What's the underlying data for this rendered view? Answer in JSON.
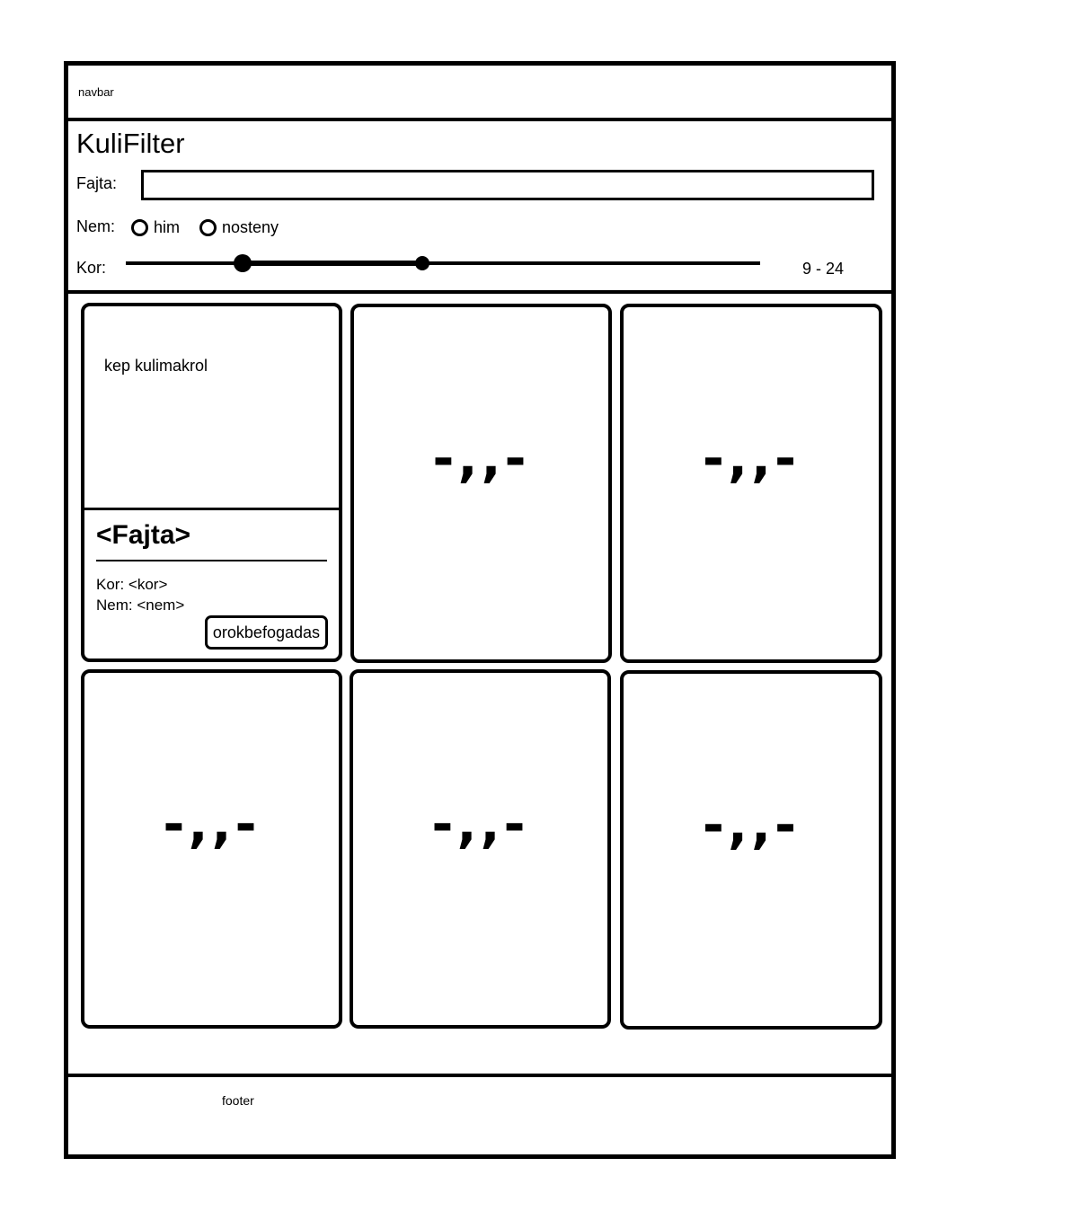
{
  "navbar": {
    "label": "navbar"
  },
  "filter": {
    "title": "KuliFilter",
    "breed_label": "Fajta:",
    "breed_value": "",
    "sex_label": "Nem:",
    "sex_options": [
      "him",
      "nosteny"
    ],
    "age_label": "Kor:",
    "age_range_text": "9 - 24"
  },
  "cards": [
    {
      "image_label": "kep kulimakrol",
      "title": "<Fajta>",
      "age_line": "Kor: <kor>",
      "sex_line": "Nem: <nem>",
      "button_label": "orokbefogadas"
    },
    {
      "placeholder": "-,,-"
    },
    {
      "placeholder": "-,,-"
    },
    {
      "placeholder": "-,,-"
    },
    {
      "placeholder": "-,,-"
    },
    {
      "placeholder": "-,,-"
    }
  ],
  "footer": {
    "label": "footer"
  }
}
